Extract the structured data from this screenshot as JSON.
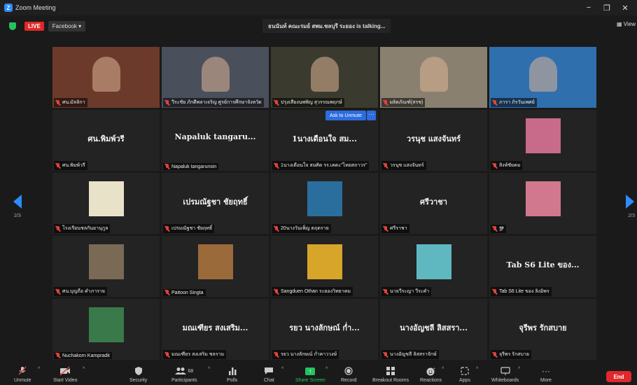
{
  "window": {
    "title": "Zoom Meeting",
    "minimize": "−",
    "restore": "❐",
    "close": "✕"
  },
  "topbar": {
    "live": "LIVE",
    "live_target": "Facebook ▾",
    "talking": "ธนนันท์ คณะรมย์ สพม.ชลบุรี ระยอง is talking...",
    "view": "▦ View"
  },
  "tiles": [
    {
      "label": "ศน.มัลลิกา",
      "kind": "video",
      "bg": "#6b3a2a"
    },
    {
      "label": "วีระชัย ภักดีพลาเจริญ ศูรย์การศึกษาจังหวัด",
      "kind": "video",
      "bg": "#4a4f5c"
    },
    {
      "label": "ปรุงเสียงนพพิญ สุวรรณพฤกษ์",
      "kind": "video",
      "bg": "#3b3a2e"
    },
    {
      "label": "ผลิตภัณฑ์(สรช)",
      "kind": "video",
      "bg": "#8a8070"
    },
    {
      "label": "ภารา ภิรวันเพศย์",
      "kind": "video",
      "bg": "#2f6fae"
    },
    {
      "display": "ศน.พิมพ์วรี",
      "label": "ศน.พิมพ์วรี",
      "kind": "name"
    },
    {
      "display": "Napaluk tangaru...",
      "label": "Napaluk tangarunsin",
      "kind": "name"
    },
    {
      "display": "1นางเดือนใจ สม...",
      "label": "1นางเดือนใจ สมศิด รร.เคดะ\"ไทยสถาวร\"",
      "kind": "name"
    },
    {
      "display": "วรนุช แสงจันทร์",
      "label": "วรนุช แสงจันทร์",
      "kind": "name"
    },
    {
      "label": "สิงห์ชัยคม",
      "kind": "pic",
      "bg": "#c86a8a"
    },
    {
      "label": "โรงเรียนชลกันยานุกูล",
      "kind": "pic",
      "bg": "#e8e2c8"
    },
    {
      "display": "เปรมณัฐชา ชัยฤทธิ์",
      "label": "เปรมณัฐชา ชัยฤทธิ์",
      "kind": "name"
    },
    {
      "label": "20นางวันเพ็ญ ตฤตราย",
      "kind": "pic",
      "bg": "#2a6e9e"
    },
    {
      "display": "ศรีวาชา",
      "label": "ศรีราชา",
      "kind": "name"
    },
    {
      "label": "梦",
      "kind": "pic",
      "bg": "#d2788e"
    },
    {
      "label": "ศน.บุญถือ คำภาราย",
      "kind": "pic",
      "bg": "#7a6a55"
    },
    {
      "label": "Paitoon Singta",
      "kind": "pic",
      "bg": "#9a6a3a"
    },
    {
      "label": "Sangduen Othan ระยองวิทยาคม",
      "kind": "pic",
      "bg": "#d6a52a"
    },
    {
      "label": "นายวีระญา วีระคำ",
      "kind": "pic",
      "bg": "#5fb8c0"
    },
    {
      "display": "Tab S6 Lite ของ...",
      "label": "Tab S6 Lite ของ ลิงอิพร",
      "kind": "name"
    },
    {
      "label": "Nuchakorn Kampradit",
      "kind": "pic",
      "bg": "#3a7a4a"
    },
    {
      "display": "มณเฑียร สงเสริม...",
      "label": "มณเฑียร สงเสริม ชลราม",
      "kind": "name"
    },
    {
      "display": "รยว นางลักษณ์ ก่ำ...",
      "label": "รยว นางลักษณ์ ก่ำคาววงษ์",
      "kind": "name"
    },
    {
      "display": "นางอัญชลี ลิสสรา...",
      "label": "นางอัญชลี ลิสสราจักษ์",
      "kind": "name"
    },
    {
      "display": "จุรีพร รักสบาย",
      "label": "จุรีพร รักสบาย",
      "kind": "name"
    }
  ],
  "ask_unmute": {
    "label": "Ask to Unmute",
    "more": "···"
  },
  "pager": {
    "left": "2/3",
    "right": "2/3"
  },
  "toolbar": {
    "unmute": "Unmute",
    "start_video": "Start Video",
    "security": "Security",
    "participants": "Participants",
    "participants_count": "68",
    "polls": "Polls",
    "chat": "Chat",
    "share_screen": "Share Screen",
    "record": "Record",
    "breakout": "Breakout Rooms",
    "reactions": "Reactions",
    "apps": "Apps",
    "whiteboards": "Whiteboards",
    "more": "More",
    "end": "End"
  },
  "colors": {
    "accent": "#2d8cff",
    "share_green": "#23c45e",
    "end_red": "#e0282e"
  }
}
